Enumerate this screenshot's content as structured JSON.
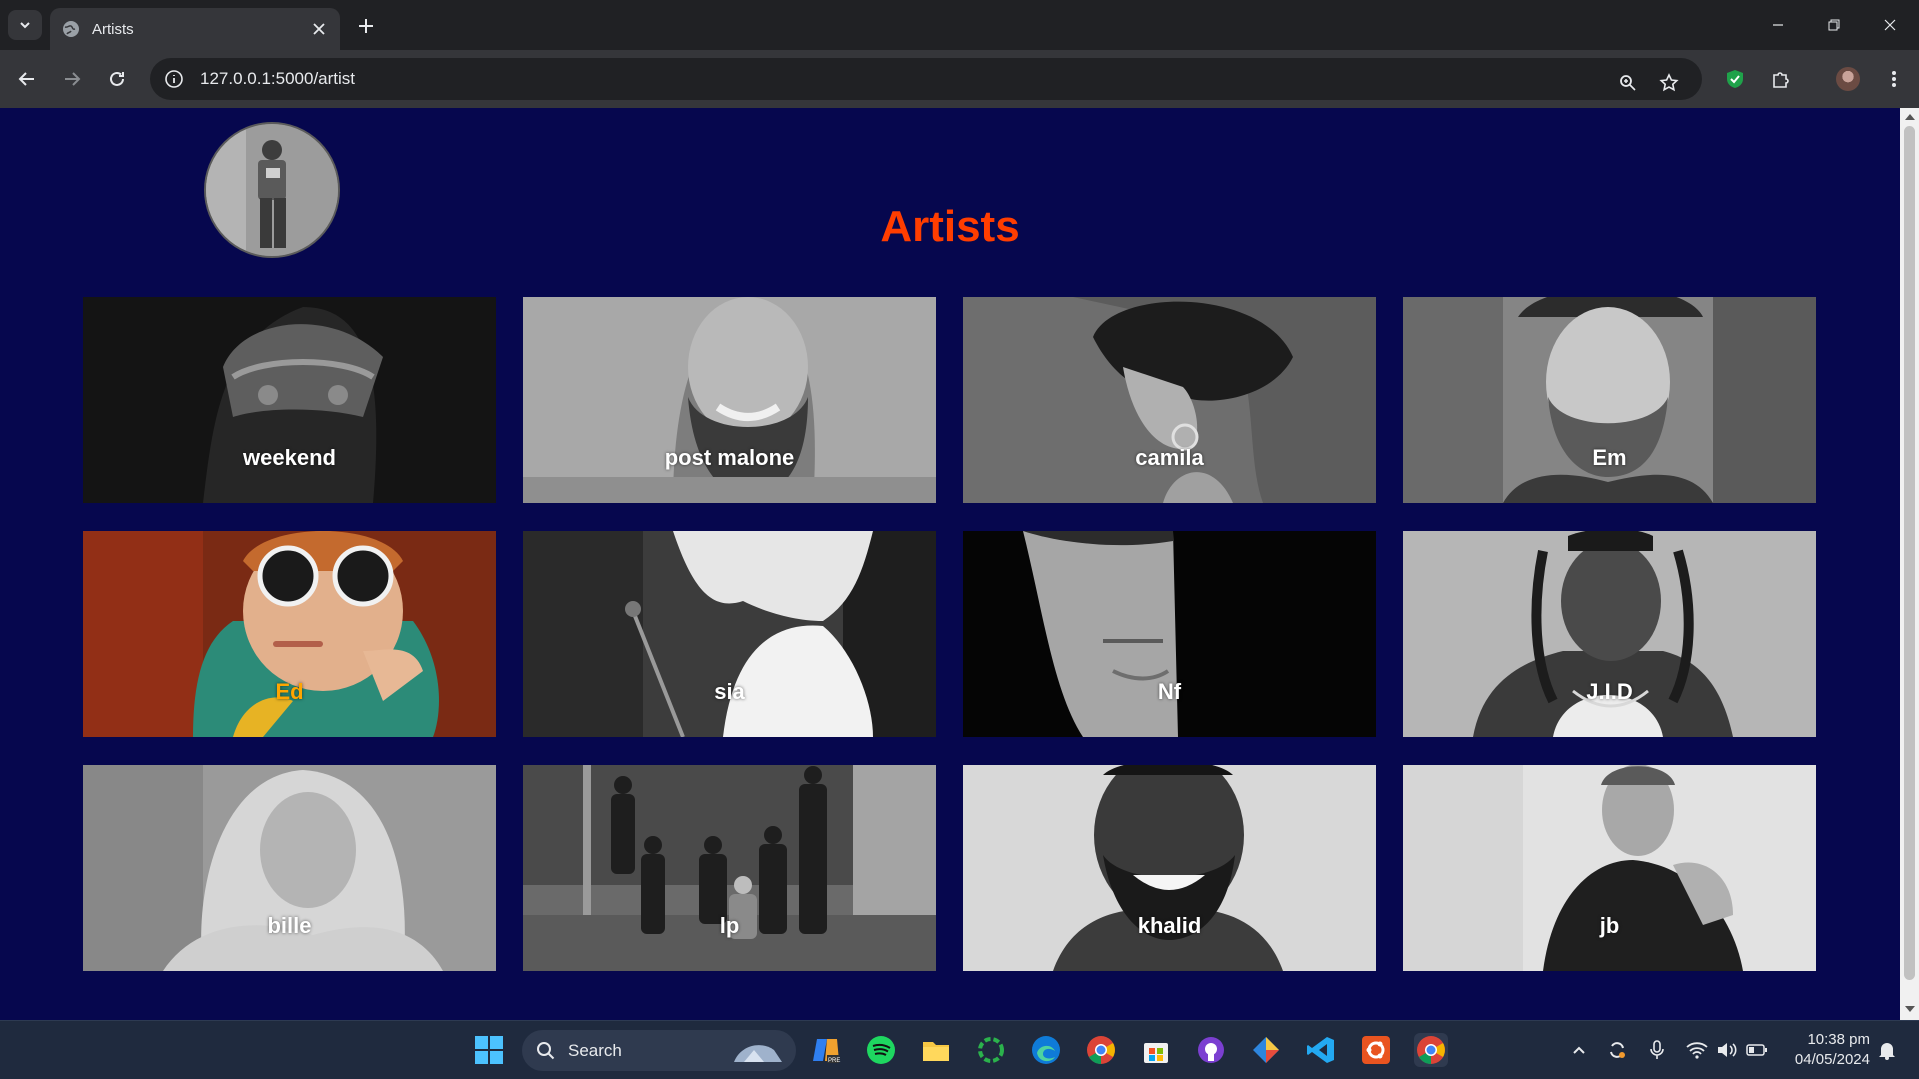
{
  "browser": {
    "tab_title": "Artists",
    "url": "127.0.0.1:5000/artist",
    "tab_icon": "globe-icon"
  },
  "page": {
    "heading": "Artists",
    "heading_color": "#ff3d00",
    "background": "#06074e",
    "active_label_color": "#ffa500"
  },
  "artists": [
    {
      "name": "weekend"
    },
    {
      "name": "post malone"
    },
    {
      "name": "camila"
    },
    {
      "name": "Em"
    },
    {
      "name": "Ed"
    },
    {
      "name": "sia"
    },
    {
      "name": "Nf"
    },
    {
      "name": "J.I.D"
    },
    {
      "name": "bille"
    },
    {
      "name": "lp"
    },
    {
      "name": "khalid"
    },
    {
      "name": "jb"
    }
  ],
  "taskbar": {
    "search_label": "Search",
    "time": "10:38 pm",
    "date": "04/05/2024"
  }
}
